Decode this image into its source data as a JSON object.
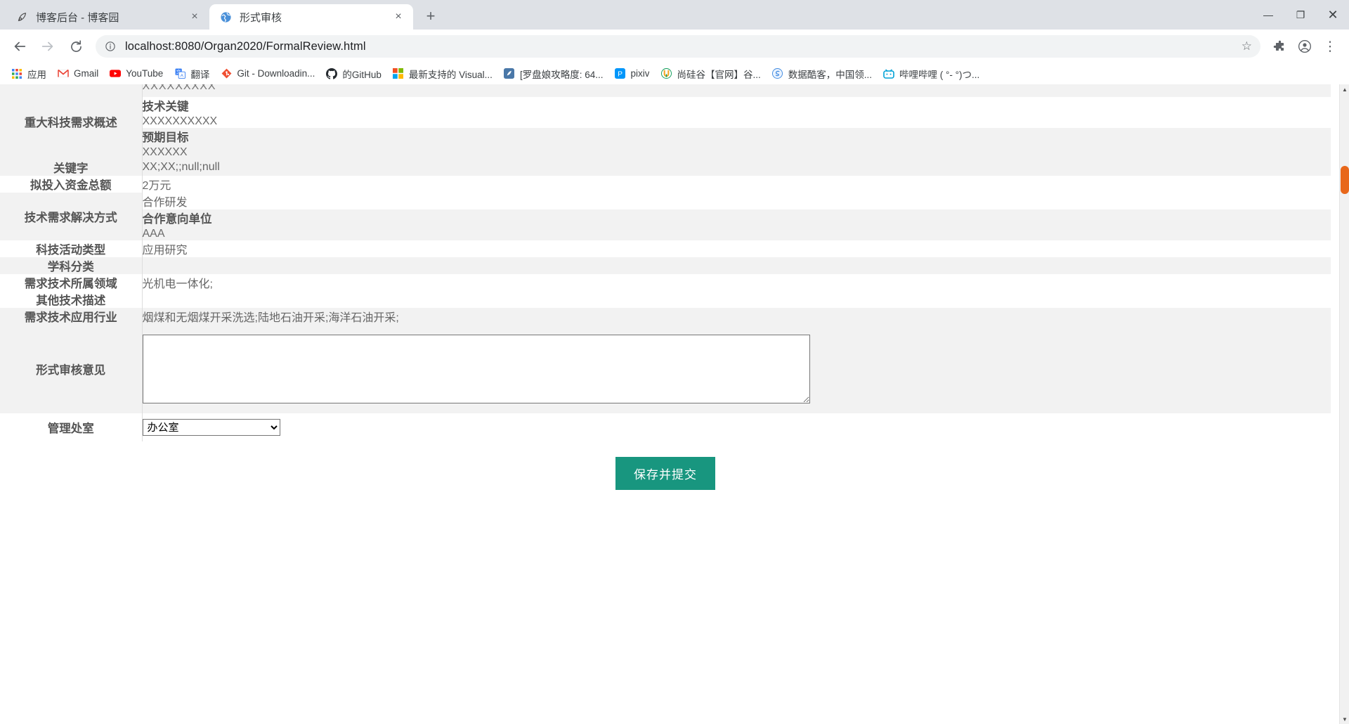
{
  "browser": {
    "tabs": [
      {
        "title": "博客后台 - 博客园",
        "favicon": "bloghome-icon",
        "active": false,
        "close_label": "×"
      },
      {
        "title": "形式审核",
        "favicon": "globe-icon",
        "active": true,
        "close_label": "×"
      }
    ],
    "new_tab_label": "+",
    "window_controls": {
      "minimize": "—",
      "maximize": "❐",
      "close": "✕"
    },
    "toolbar": {
      "back": "←",
      "forward": "→",
      "reload": "⟳",
      "info_icon": "ⓘ",
      "url": "localhost:8080/Organ2020/FormalReview.html",
      "star": "☆",
      "extensions": "⬚",
      "profile": "●",
      "menu": "⋮"
    },
    "bookmarks": [
      {
        "label": "应用",
        "icon": "apps-grid-icon"
      },
      {
        "label": "Gmail",
        "icon": "gmail-icon"
      },
      {
        "label": "YouTube",
        "icon": "youtube-icon"
      },
      {
        "label": "翻译",
        "icon": "translate-icon"
      },
      {
        "label": "Git - Downloadin...",
        "icon": "git-icon"
      },
      {
        "label": "的GitHub",
        "icon": "github-icon"
      },
      {
        "label": "最新支持的 Visual...",
        "icon": "microsoft-icon"
      },
      {
        "label": "[罗盘娘攻略度: 64...",
        "icon": "compass-icon"
      },
      {
        "label": "pixiv",
        "icon": "pixiv-icon"
      },
      {
        "label": "尚硅谷【官网】谷...",
        "icon": "atguigu-icon"
      },
      {
        "label": "数据酷客，中国领...",
        "icon": "datacoke-icon"
      },
      {
        "label": "哔哩哔哩 ( °- °)つ...",
        "icon": "bilibili-icon"
      }
    ]
  },
  "form": {
    "clipped_top_value": "XXXXXXXXX",
    "rows": [
      {
        "label": "重大科技需求概述",
        "blocks": [
          {
            "title": "技术关键",
            "value": "XXXXXXXXXX"
          },
          {
            "title": "预期目标",
            "value": "XXXXXX"
          }
        ]
      },
      {
        "label": "关键字",
        "value": "XX;XX;;null;null"
      },
      {
        "label": "拟投入资金总额",
        "value": "2万元"
      },
      {
        "label": "技术需求解决方式",
        "plain": "合作研发",
        "blocks": [
          {
            "title": "合作意向单位",
            "value": "AAA"
          }
        ]
      },
      {
        "label": "科技活动类型",
        "value": "应用研究"
      },
      {
        "label": "学科分类",
        "value": ""
      },
      {
        "label": "需求技术所属领域",
        "value": "光机电一体化;"
      },
      {
        "label": "其他技术描述",
        "value": ""
      },
      {
        "label": "需求技术应用行业",
        "value": "烟煤和无烟煤开采洗选;陆地石油开采;海洋石油开采;"
      }
    ],
    "opinion": {
      "label": "形式审核意见",
      "value": "",
      "placeholder": ""
    },
    "office": {
      "label": "管理处室",
      "selected": "办公室",
      "options": [
        "办公室"
      ]
    },
    "submit_label": "保存并提交"
  },
  "scrollbar": {
    "up_arrow": "▲",
    "down_arrow": "▼",
    "thumb_color": "#e8671a"
  }
}
